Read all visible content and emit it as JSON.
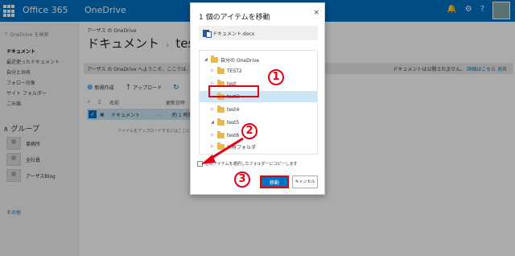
{
  "topbar": {
    "app_name": "Office 365",
    "product": "OneDrive"
  },
  "leftnav": {
    "search_placeholder": "OneDrive を検索",
    "items": [
      {
        "label": "ドキュメント",
        "active": true
      },
      {
        "label": "最近使ったドキュメント"
      },
      {
        "label": "自分と共有"
      },
      {
        "label": "フォロー対象"
      },
      {
        "label": "サイト フォルダー"
      },
      {
        "label": "ごみ箱"
      }
    ],
    "groups_title": "グループ",
    "groups": [
      "事務所",
      "全社員",
      "アーザスBlog"
    ],
    "more": "その他"
  },
  "main": {
    "owner": "アーザス の OneDrive",
    "title": "ドキュメント",
    "title_sub": "test",
    "info_text": "アーザス の OneDrive へようこそ。ここでは、作",
    "info_right": "ドキュメントは公開されません。",
    "info_links": "詳細はこちら  消去",
    "cmd_new": "新規作成",
    "cmd_upload": "アップロード",
    "col_name": "名前",
    "col_modified": "更新日時",
    "row_name": "ドキュメント",
    "row_modified": "約 1 時間",
    "drop_hint": "ファイルをアップロードするにはここに"
  },
  "dialog": {
    "title": "1 個のアイテムを移動",
    "close": "×",
    "file_name": "ドキュメント.docx",
    "tree": [
      {
        "label": "自分の OneDrive",
        "expanded": true
      },
      {
        "label": "TEST2"
      },
      {
        "label": "test"
      },
      {
        "label": "test3",
        "selected": true
      },
      {
        "label": "test4"
      },
      {
        "label": "test5",
        "expanded": true
      },
      {
        "label": "test6"
      },
      {
        "label": "共有フォルダ"
      }
    ],
    "copy_label": "このアイテムを選択したフォルダーにコピーします",
    "move_button": "移動",
    "cancel_button": "キャンセル"
  },
  "annotations": {
    "step1": "1",
    "step2": "2",
    "step3": "3",
    "color": "#e60012"
  }
}
